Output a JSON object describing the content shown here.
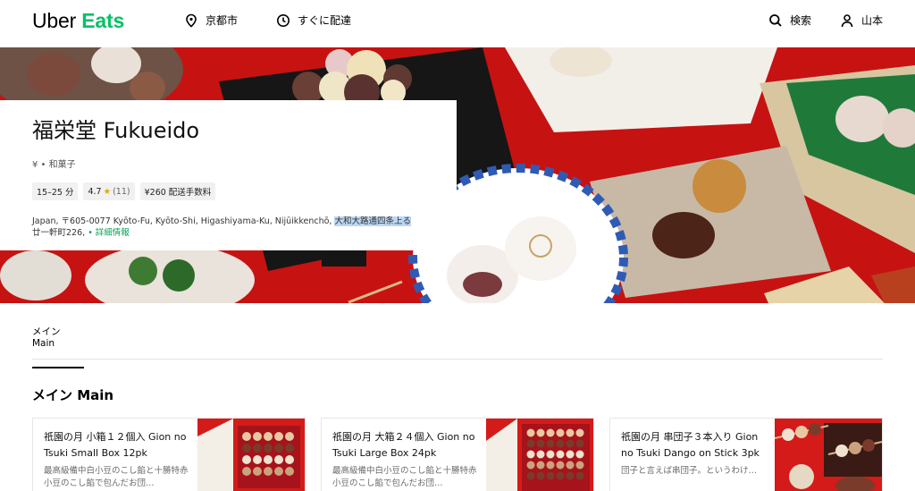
{
  "header": {
    "logo_uber": "Uber",
    "logo_eats": "Eats",
    "location": "京都市",
    "delivery_time": "すぐに配達",
    "search": "検索",
    "user": "山本"
  },
  "store": {
    "name": "福栄堂 Fukueido",
    "category": "¥ • 和菓子",
    "eta": "15–25 分",
    "rating": "4.7",
    "rating_count": "(11)",
    "delivery_fee": "¥260 配送手数料",
    "address_part1": "Japan, 〒605-0077 Kyōto-Fu, Kyōto-Shi, Higashiyama-Ku, Nijūikkenchō, ",
    "address_highlight": "大和大路通四条上る",
    "address_part2": "廿一軒町226, ",
    "address_link": "• 詳細情報"
  },
  "tabs": [
    {
      "label": "メイン Main"
    }
  ],
  "section": {
    "title": "メイン Main"
  },
  "items": [
    {
      "title": "祇園の月 小箱１２個入 Gion no Tsuki Small Box 12pk",
      "description": "最高級備中白小豆のこし餡と十勝特赤小豆のこし餡で包んだお団…"
    },
    {
      "title": "祇園の月 大箱２４個入 Gion no Tsuki Large Box 24pk",
      "description": "最高級備中白小豆のこし餡と十勝特赤小豆のこし餡で包んだお団…"
    },
    {
      "title": "祇園の月 串団子３本入り Gion no Tsuki Dango on Stick 3pk",
      "description": "団子と言えば串団子。というわけ…"
    }
  ],
  "colors": {
    "brand_green": "#06c167",
    "hero_red": "#d01515"
  }
}
